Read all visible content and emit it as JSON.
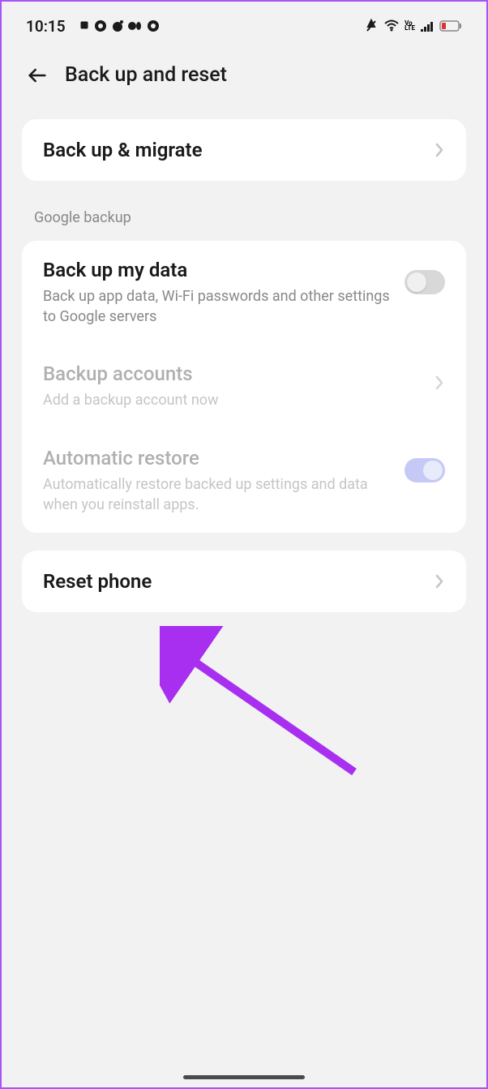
{
  "statusBar": {
    "time": "10:15"
  },
  "header": {
    "title": "Back up and reset"
  },
  "backupMigrate": {
    "title": "Back up & migrate"
  },
  "sectionHeader": "Google backup",
  "backupMyData": {
    "title": "Back up my data",
    "desc": "Back up app data, Wi-Fi passwords and other settings to Google servers"
  },
  "backupAccounts": {
    "title": "Backup accounts",
    "desc": "Add a backup account now"
  },
  "automaticRestore": {
    "title": "Automatic restore",
    "desc": "Automatically restore backed up settings and data when you reinstall apps."
  },
  "resetPhone": {
    "title": "Reset phone"
  }
}
